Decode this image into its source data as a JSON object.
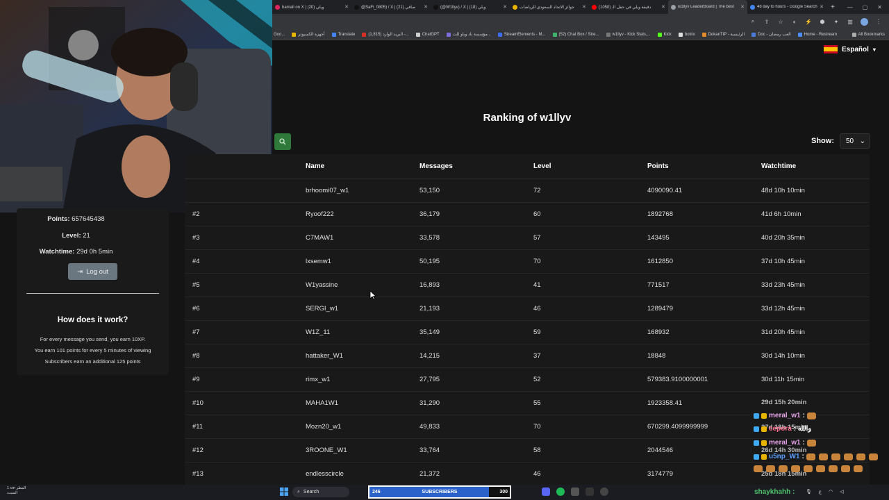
{
  "browser": {
    "tabs": [
      {
        "label": "hamali on X | ويلي (20)",
        "color": "#e0245e"
      },
      {
        "label": "@SaFi_0805) / X | صافي (21)",
        "color": "#111111"
      },
      {
        "label": "(@W1llyv) / X | ويلي (18)",
        "color": "#111111"
      },
      {
        "label": "جوائز الاتحاد السعودي للرياضات",
        "color": "#e8b400"
      },
      {
        "label": "(1050) دقيقة ويلي في حفل الـ",
        "color": "#ff0000"
      },
      {
        "label": "w1llyv LeaderBoard | The best",
        "color": "#9aa0a6"
      },
      {
        "label": "48 day to hours - Google Search",
        "color": "#4285f4"
      }
    ],
    "bookmarks": [
      "Goo...",
      "أجهزة الكمبيوتر",
      "Translate",
      "البريد الوارد (1,815) -...",
      "ChatGPT",
      "مؤسسة باد وباو للت...",
      "StreamElements - M...",
      "(52) Chat Box / Stre...",
      "w1llyv - Kick Stats,...",
      "Kick",
      "botrix",
      "DokanTIP - الرئيسية",
      "Doc - العب رمضان",
      "Home - Restream"
    ],
    "all_bookmarks": "All Bookmarks"
  },
  "page": {
    "language": "Español",
    "title": "Ranking of w1llyv",
    "show_label": "Show:",
    "show_value": "50"
  },
  "table": {
    "headers": [
      "Name",
      "Messages",
      "Level",
      "Points",
      "Watchtime"
    ],
    "rows": [
      {
        "rank": "",
        "name": "brhoomi07_w1",
        "messages": "53,150",
        "level": "72",
        "points": "4090090.41",
        "watchtime": "48d 10h 10min"
      },
      {
        "rank": "#2",
        "name": "Ryoof222",
        "messages": "36,179",
        "level": "60",
        "points": "1892768",
        "watchtime": "41d 6h 10min"
      },
      {
        "rank": "#3",
        "name": "C7MAW1",
        "messages": "33,578",
        "level": "57",
        "points": "143495",
        "watchtime": "40d 20h 35min"
      },
      {
        "rank": "#4",
        "name": "lxsemw1",
        "messages": "50,195",
        "level": "70",
        "points": "1612850",
        "watchtime": "37d 10h 45min"
      },
      {
        "rank": "#5",
        "name": "W1yassine",
        "messages": "16,893",
        "level": "41",
        "points": "771517",
        "watchtime": "33d 23h 45min"
      },
      {
        "rank": "#6",
        "name": "SERGI_w1",
        "messages": "21,193",
        "level": "46",
        "points": "1289479",
        "watchtime": "33d 12h 45min"
      },
      {
        "rank": "#7",
        "name": "W1Z_11",
        "messages": "35,149",
        "level": "59",
        "points": "168932",
        "watchtime": "31d 20h 45min"
      },
      {
        "rank": "#8",
        "name": "hattaker_W1",
        "messages": "14,215",
        "level": "37",
        "points": "18848",
        "watchtime": "30d 14h 10min"
      },
      {
        "rank": "#9",
        "name": "rimx_w1",
        "messages": "27,795",
        "level": "52",
        "points": "579383.9100000001",
        "watchtime": "30d 11h 15min"
      },
      {
        "rank": "#10",
        "name": "MAHA1W1",
        "messages": "31,290",
        "level": "55",
        "points": "1923358.41",
        "watchtime": ""
      },
      {
        "rank": "#11",
        "name": "Mozn20_w1",
        "messages": "49,833",
        "level": "70",
        "points": "670299.4099999999",
        "watchtime": ""
      },
      {
        "rank": "#12",
        "name": "3ROONE_W1",
        "messages": "33,764",
        "level": "58",
        "points": "2044546",
        "watchtime": ""
      },
      {
        "rank": "#13",
        "name": "endlesscircle",
        "messages": "21,372",
        "level": "46",
        "points": "3174779",
        "watchtime": ""
      }
    ]
  },
  "user": {
    "points_label": "Points:",
    "points": "657645438",
    "level_label": "Level:",
    "level": "21",
    "watchtime_label": "Watchtime:",
    "watchtime": "29d 0h 5min",
    "logout": "Log out"
  },
  "how": {
    "title": "How does it work?",
    "lines": [
      "For every message you send, you earn 10XP.",
      "You earn 101 points for every 5 minutes of viewing",
      "Subscribers earn an additional 125 points"
    ]
  },
  "chat": {
    "messages": [
      {
        "user": "meral_w1",
        "text": ":",
        "color": "#e5a3e8"
      },
      {
        "user": "cepora",
        "text": ": والله",
        "color": "#ff6b8b"
      },
      {
        "user": "meral_w1",
        "text": ":",
        "color": "#e5a3e8"
      },
      {
        "user": "u5np_W1",
        "text": ":",
        "color": "#5aa0ff"
      }
    ],
    "ghost_watchtimes": [
      "29d 15h 20min",
      "27d 18h 15min",
      "26d 14h 30min",
      "25d 18h 15min"
    ],
    "bottom_user": "shaykhahh :"
  },
  "taskbar": {
    "weather_line1": "1 cm المطر",
    "weather_line2": "السبت",
    "search": "Search",
    "subs_left": "246",
    "subs_mid": "SUBSCRIBERS",
    "subs_right": "300"
  }
}
